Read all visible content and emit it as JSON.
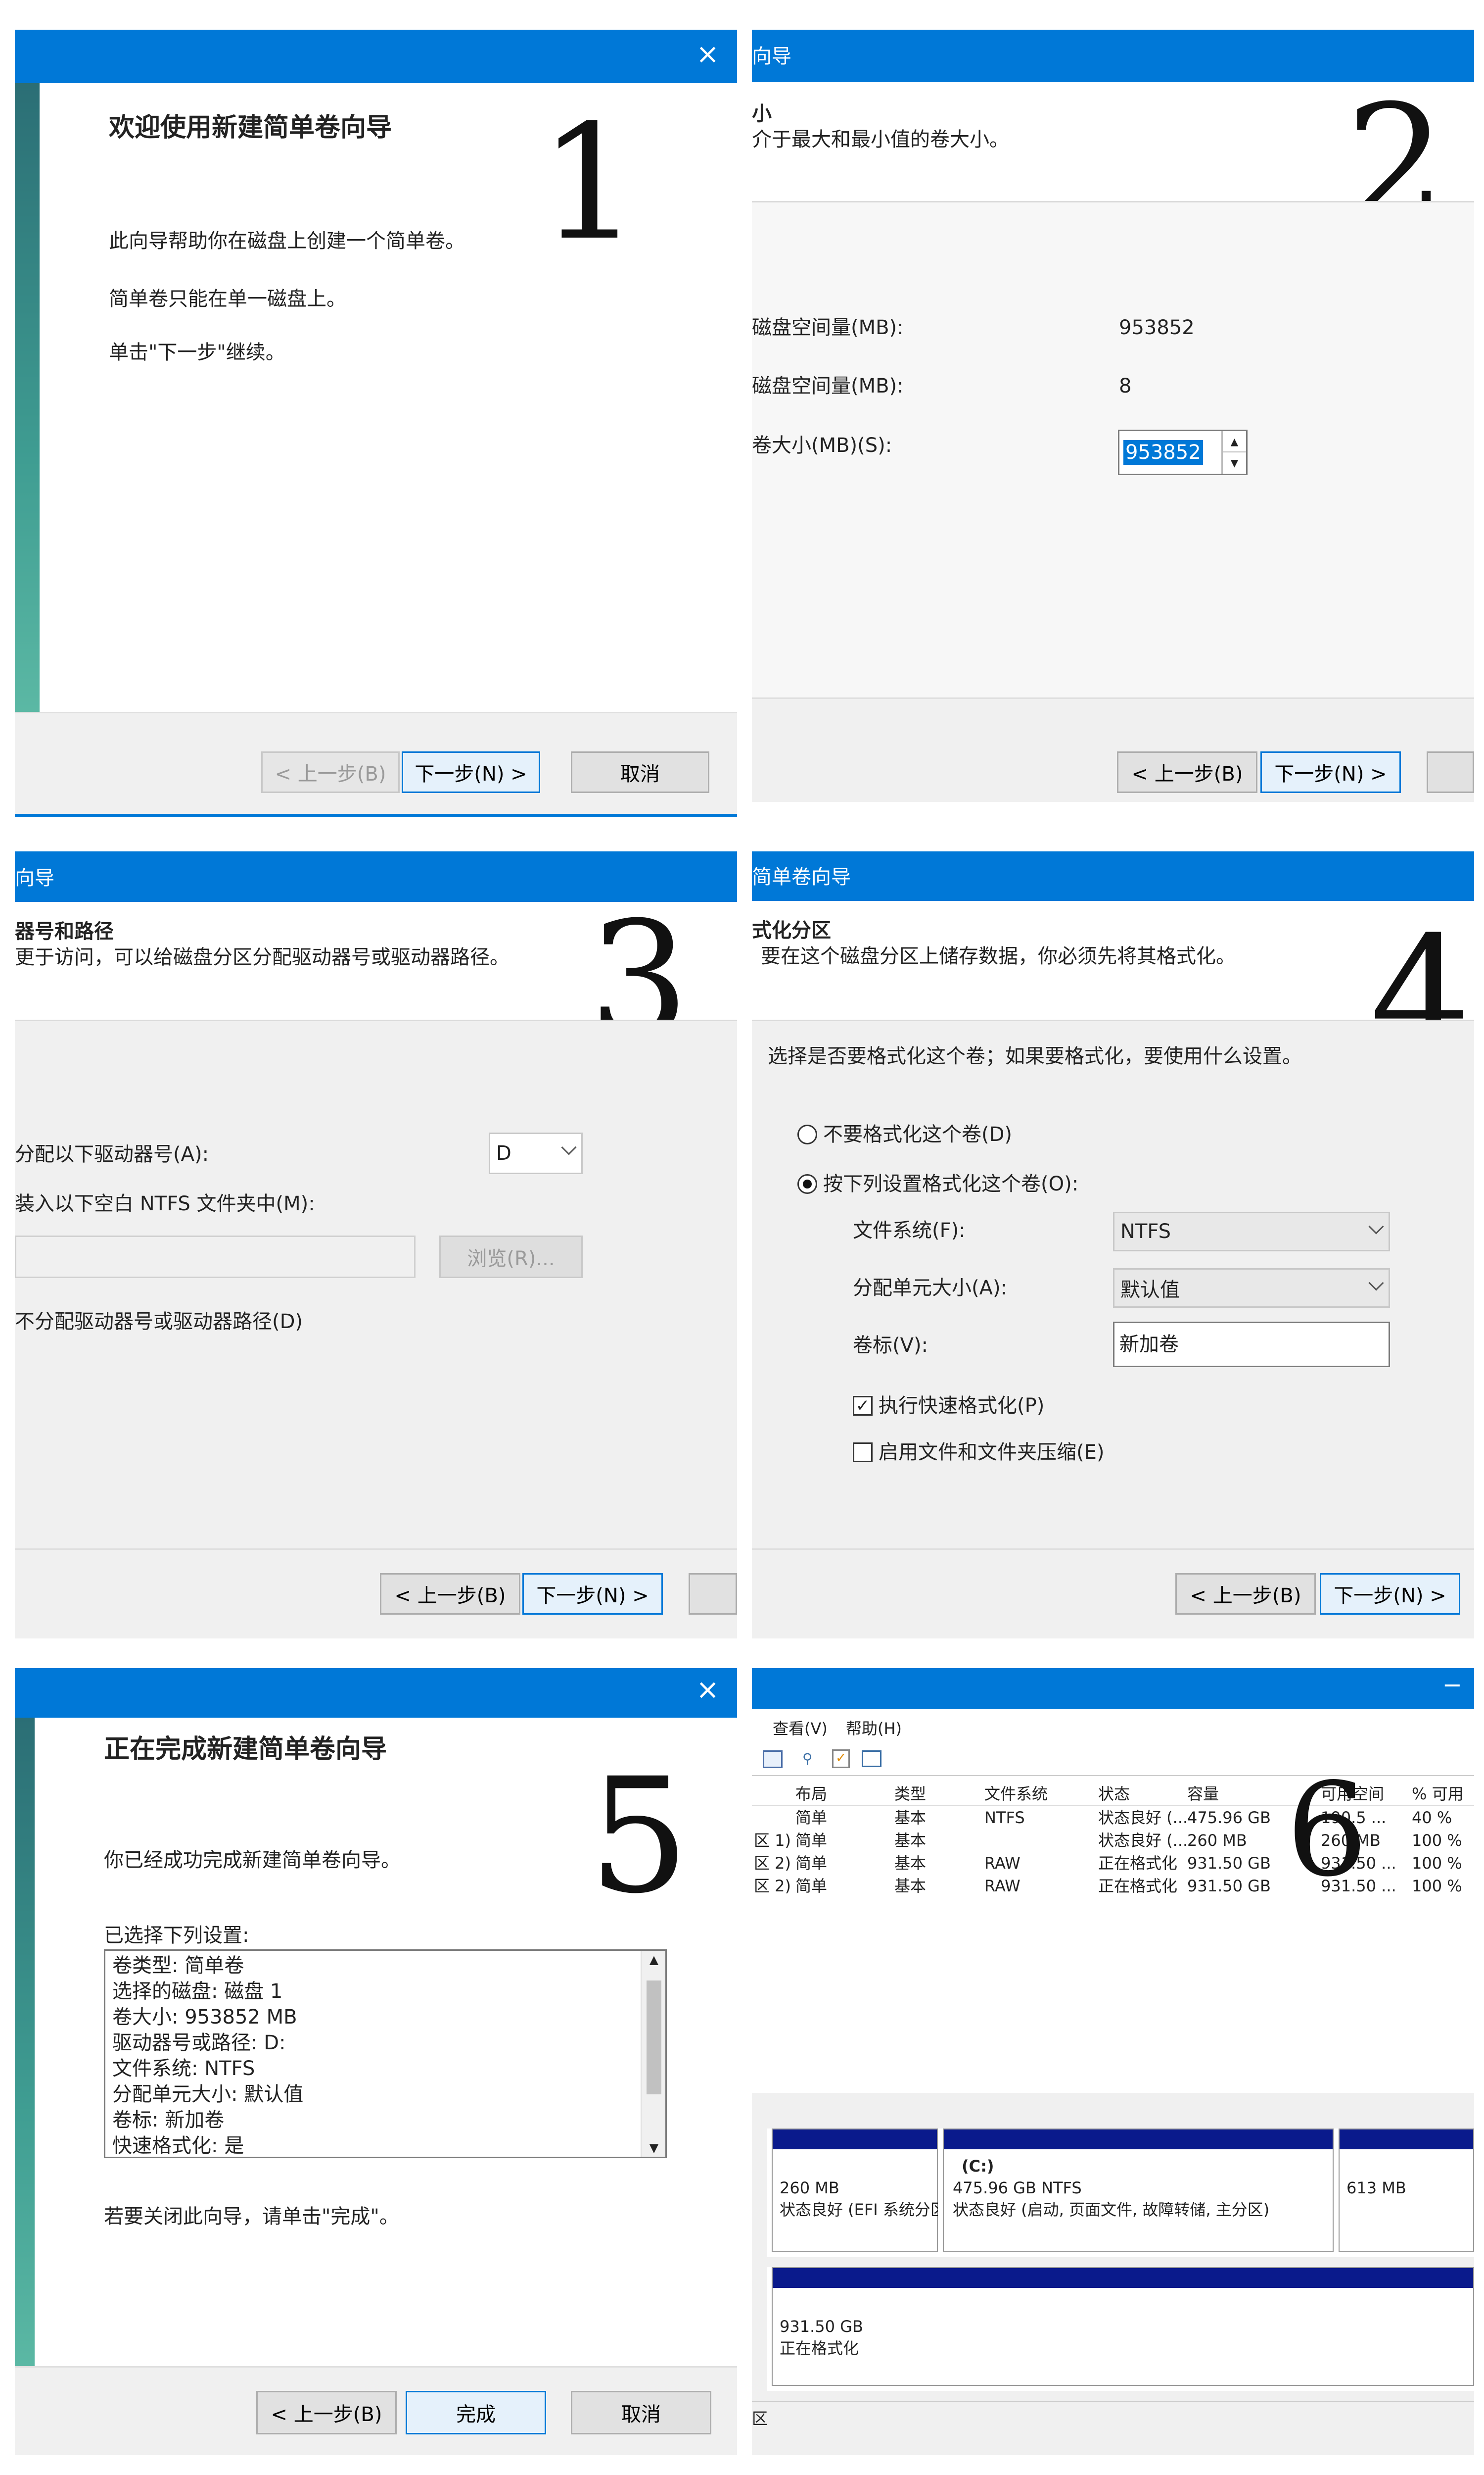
{
  "p1": {
    "step": "1",
    "close": "×",
    "title": "欢迎使用新建简单卷向导",
    "line1": "此向导帮助你在磁盘上创建一个简单卷。",
    "line2": "简单卷只能在单一磁盘上。",
    "line3": "单击\"下一步\"继续。",
    "back": "< 上一步(B)",
    "next": "下一步(N) >",
    "cancel": "取消"
  },
  "p2": {
    "step": "2",
    "title_frag": "向导",
    "heading_frag": "小",
    "desc_frag": "介于最大和最小值的卷大小。",
    "max_label": "磁盘空间量(MB):",
    "max_value": "953852",
    "min_label": "磁盘空间量(MB):",
    "min_value": "8",
    "size_label": "卷大小(MB)(S):",
    "size_value": "953852",
    "back": "< 上一步(B)",
    "next": "下一步(N) >"
  },
  "p3": {
    "step": "3",
    "title_frag": "向导",
    "heading_frag": "器号和路径",
    "desc_frag": "更于访问，可以给磁盘分区分配驱动器号或驱动器路径。",
    "opt1": "分配以下驱动器号(A):",
    "drive": "D",
    "opt2": "装入以下空白 NTFS 文件夹中(M):",
    "browse": "浏览(R)...",
    "opt3": "不分配驱动器号或驱动器路径(D)",
    "back": "< 上一步(B)",
    "next": "下一步(N) >"
  },
  "p4": {
    "step": "4",
    "title_frag": "简单卷向导",
    "heading_frag": "式化分区",
    "desc_frag": "要在这个磁盘分区上储存数据，你必须先将其格式化。",
    "prompt": "选择是否要格式化这个卷；如果要格式化，要使用什么设置。",
    "radio1": "不要格式化这个卷(D)",
    "radio2": "按下列设置格式化这个卷(O):",
    "fs_label": "文件系统(F):",
    "fs_value": "NTFS",
    "alloc_label": "分配单元大小(A):",
    "alloc_value": "默认值",
    "vol_label": "卷标(V):",
    "vol_value": "新加卷",
    "chk1": "执行快速格式化(P)",
    "chk2": "启用文件和文件夹压缩(E)",
    "chk1_mark": "✓",
    "back": "< 上一步(B)",
    "next": "下一步(N) >"
  },
  "p5": {
    "step": "5",
    "close": "×",
    "title": "正在完成新建简单卷向导",
    "done_msg": "你已经成功完成新建简单卷向导。",
    "settings_label": "已选择下列设置:",
    "settings": [
      "卷类型: 简单卷",
      "选择的磁盘: 磁盘 1",
      "卷大小: 953852 MB",
      "驱动器号或路径: D:",
      "文件系统: NTFS",
      "分配单元大小: 默认值",
      "卷标: 新加卷",
      "快速格式化: 是"
    ],
    "close_msg": "若要关闭此向导，请单击\"完成\"。",
    "back": "< 上一步(B)",
    "finish": "完成",
    "cancel": "取消"
  },
  "p6": {
    "step": "6",
    "minimize": "−",
    "menu": [
      "查看(V)",
      "帮助(H)"
    ],
    "headers": [
      "布局",
      "类型",
      "文件系统",
      "状态",
      "容量",
      "可用空间",
      "% 可用"
    ],
    "rows": [
      {
        "vol": "",
        "layout": "简单",
        "type": "基本",
        "fs": "NTFS",
        "status": "状态良好 (...",
        "cap": "475.96 GB",
        "free": "190.5 ...",
        "pct": "40 %"
      },
      {
        "vol": "区 1)",
        "layout": "简单",
        "type": "基本",
        "fs": "",
        "status": "状态良好 (...",
        "cap": "260 MB",
        "free": "260 MB",
        "pct": "100 %"
      },
      {
        "vol": "区 2)",
        "layout": "简单",
        "type": "基本",
        "fs": "RAW",
        "status": "正在格式化",
        "cap": "931.50 GB",
        "free": "931.50 ...",
        "pct": "100 %"
      },
      {
        "vol": "区 2)",
        "layout": "简单",
        "type": "基本",
        "fs": "RAW",
        "status": "正在格式化",
        "cap": "931.50 GB",
        "free": "931.50 ...",
        "pct": "100 %"
      }
    ],
    "d0_p1_size": "260 MB",
    "d0_p1_status": "状态良好 (EFI 系统分区)",
    "d0_p2_name": "(C:)",
    "d0_p2_size": "475.96 GB NTFS",
    "d0_p2_status": "状态良好 (启动, 页面文件, 故障转储, 主分区)",
    "d0_p3_size": "613 MB",
    "d1_size": "931.50 GB",
    "d1_status": "正在格式化",
    "footer_frag": "区"
  },
  "colors": {
    "titlebar": "#0078d7",
    "disk_bar": "#0a1a8c",
    "accent_border": "#0078d7"
  }
}
